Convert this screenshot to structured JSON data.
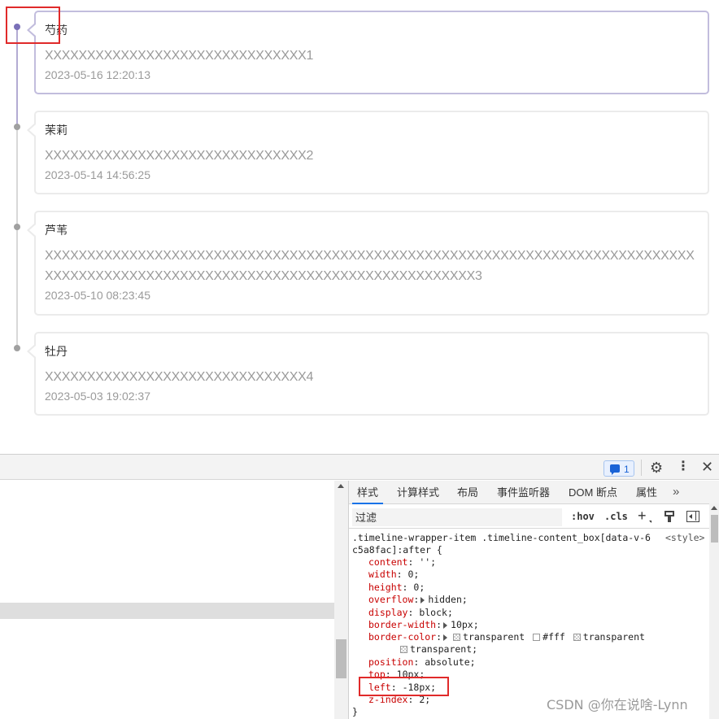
{
  "timeline": {
    "items": [
      {
        "name": "芍药",
        "content": "XXXXXXXXXXXXXXXXXXXXXXXXXXXXXXX1",
        "time": "2023-05-16 12:20:13",
        "active": true
      },
      {
        "name": "茉莉",
        "content": "XXXXXXXXXXXXXXXXXXXXXXXXXXXXXXX2",
        "time": "2023-05-14 14:56:25",
        "active": false
      },
      {
        "name": "芦苇",
        "content": "XXXXXXXXXXXXXXXXXXXXXXXXXXXXXXXXXXXXXXXXXXXXXXXXXXXXXXXXXXXXXXXXXXXXXXXXXXXXXXXXXXXXXXXXXXXXXXXXXXXXXXXXXXXXXXXXXXXXXXXXXXXXXXXX3",
        "time": "2023-05-10 08:23:45",
        "active": false
      },
      {
        "name": "牡丹",
        "content": "XXXXXXXXXXXXXXXXXXXXXXXXXXXXXXX4",
        "time": "2023-05-03 19:02:37",
        "active": false
      }
    ]
  },
  "devtools": {
    "message_count": "1",
    "tabs": [
      "样式",
      "计算样式",
      "布局",
      "事件监听器",
      "DOM 断点",
      "属性"
    ],
    "more_tabs_glyph": "»",
    "filter_placeholder": "过滤",
    "hov_label": ":hov",
    "cls_label": ".cls",
    "rule": {
      "selector": ".timeline-wrapper-item .timeline-content_box[data-v-6c5a8fac]:after {",
      "source": "<style>",
      "declarations": [
        {
          "prop": "content",
          "val": "'';"
        },
        {
          "prop": "width",
          "val": "0;"
        },
        {
          "prop": "height",
          "val": "0;"
        },
        {
          "prop": "overflow",
          "val": "hidden;"
        },
        {
          "prop": "display",
          "val": "block;"
        },
        {
          "prop": "border-width",
          "val": "10px;"
        },
        {
          "prop": "border-color",
          "val1": "transparent",
          "val2": "#fff",
          "val3": "transparent",
          "val4": "transparent;"
        },
        {
          "prop": "position",
          "val": "absolute;"
        },
        {
          "prop": "top",
          "val": "10px;"
        },
        {
          "prop": "left",
          "val": "-18px;"
        },
        {
          "prop": "z-index",
          "val": "2;"
        }
      ],
      "closing": "}"
    }
  },
  "watermark": "CSDN @你在说啥-Lynn",
  "colors": {
    "accent_purple": "#7a70b8",
    "highlight_red": "#e02a2a",
    "prop_red": "#c80000",
    "tab_blue": "#1a73e8"
  }
}
